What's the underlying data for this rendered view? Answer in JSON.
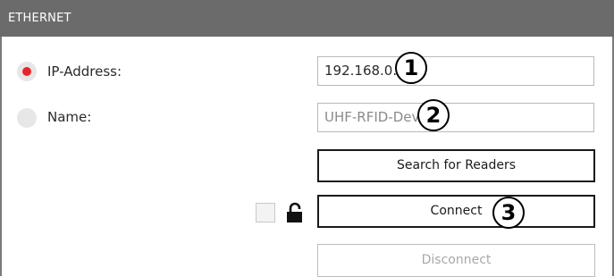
{
  "panel": {
    "title": "ETHERNET"
  },
  "connection_mode": {
    "ip_option": {
      "label": "IP-Address:",
      "selected": true,
      "value": "192.168.0.1"
    },
    "name_option": {
      "label": "Name:",
      "selected": false,
      "placeholder": "UHF-RFID-Device"
    }
  },
  "buttons": {
    "search_label": "Search for Readers",
    "connect_label": "Connect",
    "disconnect_label": "Disconnect"
  },
  "lock": {
    "checked": false,
    "icon": "unlocked-padlock-icon"
  },
  "callouts": [
    "1",
    "2",
    "3"
  ],
  "colors": {
    "header_bg": "#6b6b6b",
    "radio_selected": "#e8242a"
  }
}
